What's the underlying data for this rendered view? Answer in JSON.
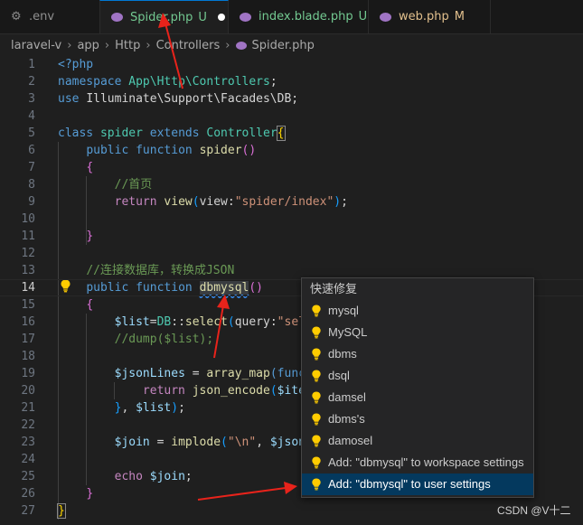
{
  "tabs": [
    {
      "label": ".env",
      "status": ""
    },
    {
      "label": "Spider.php",
      "status": "U"
    },
    {
      "label": "index.blade.php",
      "status": "U"
    },
    {
      "label": "web.php",
      "status": "M"
    }
  ],
  "breadcrumb": [
    "laravel-v",
    "app",
    "Http",
    "Controllers",
    "Spider.php"
  ],
  "line_numbers": [
    "1",
    "2",
    "3",
    "4",
    "5",
    "6",
    "7",
    "8",
    "9",
    "10",
    "11",
    "12",
    "13",
    "14",
    "15",
    "16",
    "17",
    "18",
    "19",
    "20",
    "21",
    "22",
    "23",
    "24",
    "25",
    "26",
    "27"
  ],
  "active_line": "14",
  "code": {
    "l1_open": "<?php",
    "l2_ns_kw": "namespace",
    "l2_ns": "App\\Http\\Controllers",
    "l3_use_kw": "use",
    "l3_use": "Illuminate\\Support\\Facades\\DB",
    "l5_class_kw": "class",
    "l5_class_name": "spider",
    "l5_extends_kw": "extends",
    "l5_parent": "Controller",
    "l6_public": "public",
    "l6_function": "function",
    "l6_name": "spider",
    "l8_comment": "//首页",
    "l9_return": "return",
    "l9_view_fn": "view",
    "l9_param": "view:",
    "l9_string": "\"spider/index\"",
    "l13_comment": "//连接数据库，转换成JSON",
    "l14_public": "public",
    "l14_function": "function",
    "l14_name": "dbmysql",
    "l16_var": "$list",
    "l16_db": "DB",
    "l16_select": "select",
    "l16_param": "query:",
    "l16_string": "\"sel",
    "l17_comment": "//dump($list);",
    "l19_var": "$jsonLines",
    "l19_fn": "array_map",
    "l19_rest": "(func",
    "l20_return": "return",
    "l20_fn": "json_encode",
    "l20_var": "$ite",
    "l21_var": "$list",
    "l23_var": "$join",
    "l23_fn": "implode",
    "l23_string": "\"\\n\"",
    "l23_var2": "$json",
    "l25_echo": "echo",
    "l25_var": "$join"
  },
  "quickfix": {
    "title": "快速修复",
    "items": [
      "mysql",
      "MySQL",
      "dbms",
      "dsql",
      "damsel",
      "dbms's",
      "damosel",
      "Add: \"dbmysql\" to workspace settings",
      "Add: \"dbmysql\" to user settings"
    ],
    "selected_index": 8
  },
  "watermark": "CSDN @V十二",
  "colors": {
    "modified_untracked": "#73c991",
    "modified": "#e2c08d",
    "bulb": "#ffcc00",
    "annotation_arrow": "#e8231b",
    "selection": "#04395e"
  }
}
